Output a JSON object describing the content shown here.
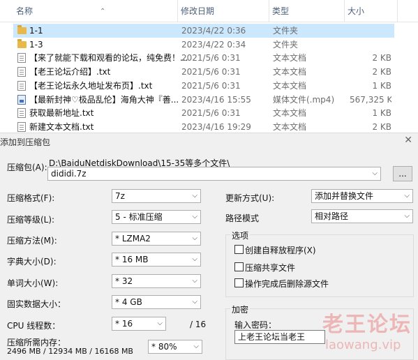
{
  "explorer": {
    "columns": {
      "name": "名称",
      "date": "修改日期",
      "type": "类型",
      "size": "大小"
    },
    "files": [
      {
        "name": "1-1",
        "date": "2023/4/22 0:36",
        "type": "文件夹",
        "size": "",
        "icon": "folder-icon"
      },
      {
        "name": "1-3",
        "date": "2023/4/22 0:34",
        "type": "文件夹",
        "size": "",
        "icon": "folder-icon"
      },
      {
        "name": "【来了就能下载和观看的论坛，纯免费！...",
        "date": "2021/5/6 0:31",
        "type": "文本文档",
        "size": "2 KB",
        "icon": "text-document-icon"
      },
      {
        "name": "【老王论坛介绍】.txt",
        "date": "2021/5/6 0:31",
        "type": "文本文档",
        "size": "2 KB",
        "icon": "text-document-icon"
      },
      {
        "name": "【老王论坛永久地址发布页】.txt",
        "date": "2021/5/6 0:31",
        "type": "文本文档",
        "size": "1 KB",
        "icon": "text-document-icon"
      },
      {
        "name": "【最新封神♡极品乱伦】海角大神『善...",
        "date": "2023/4/16 15:55",
        "type": "媒体文件(.mp4)",
        "size": "567,325 KB",
        "icon": "media-file-icon"
      },
      {
        "name": "获取最新地址.txt",
        "date": "2021/5/6 0:31",
        "type": "文本文档",
        "size": "1 KB",
        "icon": "text-document-icon"
      },
      {
        "name": "新建文本文档.txt",
        "date": "2023/4/16 19:29",
        "type": "文本文档",
        "size": "2 KB",
        "icon": "text-document-icon"
      }
    ]
  },
  "dialog": {
    "title": "添加到压缩包",
    "close": "✕",
    "archive_label": "压缩包(A):",
    "archive_path": "D:\\BaiduNetdiskDownload\\15-35等多个文件\\",
    "archive_name": "dididi.7z",
    "browse_label": "...",
    "format_label": "压缩格式(F):",
    "format_value": "7z",
    "level_label": "压缩等级(L):",
    "level_value": "5 - 标准压缩",
    "method_label": "压缩方法(M):",
    "method_value": "* LZMA2",
    "dict_label": "字典大小(D):",
    "dict_value": "* 16 MB",
    "word_label": "单词大小(W):",
    "word_value": "* 32",
    "solid_label": "固实数据大小：",
    "solid_value": "* 4 GB",
    "threads_label": "CPU 线程数：",
    "threads_value": "* 16",
    "threads_total": "/ 16",
    "memory_label": "压缩所需内存：",
    "memory_value": "2496 MB / 12934 MB / 16168 MB",
    "memory_percent": "* 80%",
    "update_label": "更新方式(U):",
    "update_value": "添加并替换文件",
    "path_mode_label": "路径模式",
    "path_mode_value": "相对路径",
    "options_title": "选项",
    "opt_sfx": "创建自释放程序(X)",
    "opt_shared": "压缩共享文件",
    "opt_delete": "操作完成后删除源文件",
    "encrypt_title": "加密",
    "password_label": "输入密码：",
    "password_value": "上老王论坛当老王"
  },
  "watermark": {
    "cn": "老王论坛",
    "en": "laowang.vip"
  }
}
